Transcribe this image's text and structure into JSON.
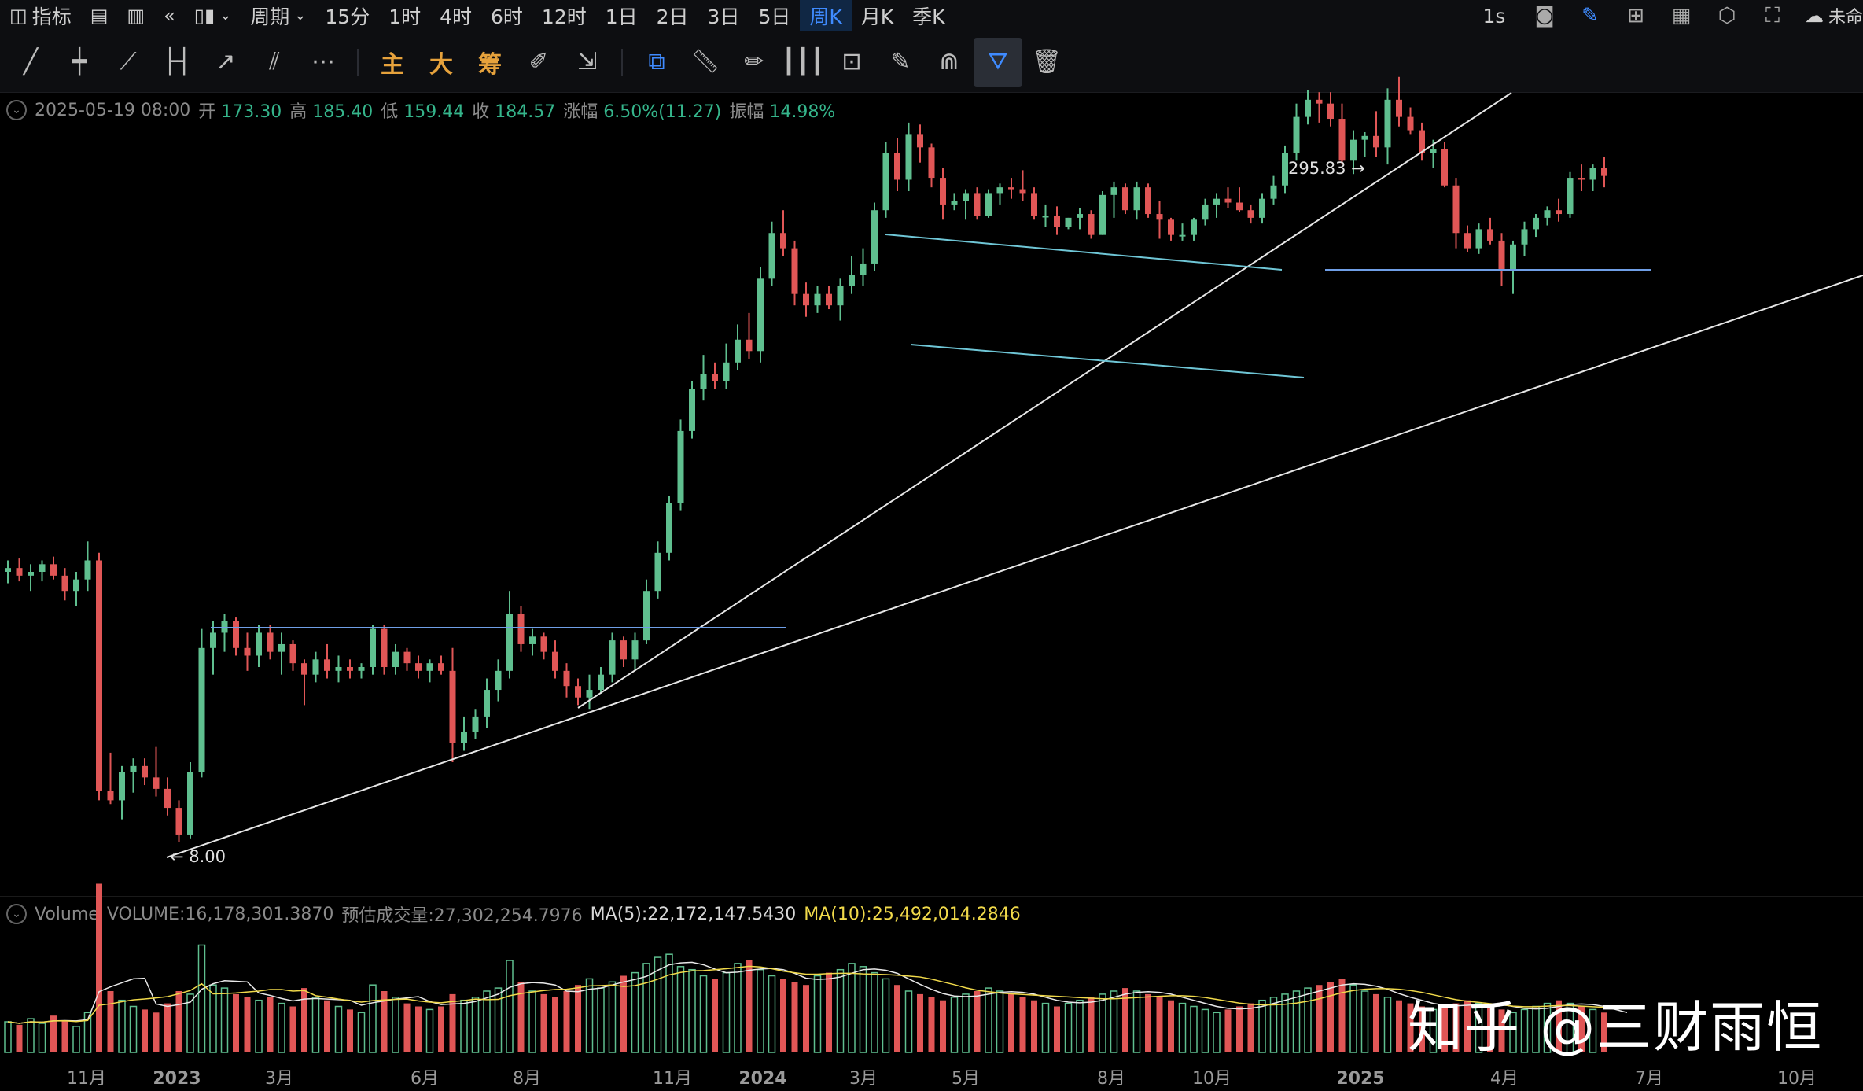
{
  "toolbar": {
    "indicators_label": "指标",
    "period_label": "周期",
    "periods": [
      "15分",
      "1时",
      "4时",
      "6时",
      "12时",
      "1日",
      "2日",
      "3日",
      "5日",
      "周K",
      "月K",
      "季K"
    ],
    "active_period": "周K",
    "interval_label": "1s",
    "cloud_label": "未命"
  },
  "drawing_tools": {
    "main_label": "主",
    "big_label": "大",
    "chip_label": "筹"
  },
  "ohlc": {
    "date": "2025-05-19 08:00",
    "open_label": "开",
    "open": "173.30",
    "high_label": "高",
    "high": "185.40",
    "low_label": "低",
    "low": "159.44",
    "close_label": "收",
    "close": "184.57",
    "change_label": "涨幅",
    "change": "6.50%(11.27)",
    "amp_label": "振幅",
    "amp": "14.98%"
  },
  "volume_info": {
    "name": "Volume",
    "volume": "VOLUME:16,178,301.3870",
    "estimate": "预估成交量:27,302,254.7976",
    "ma5": "MA(5):22,172,147.5430",
    "ma10": "MA(10):25,492,014.2846"
  },
  "annotations": {
    "high_mark": "295.83 →",
    "low_mark": "← 8.00"
  },
  "watermark": "知乎 @三财雨恒",
  "colors": {
    "up": "#5fbf8f",
    "down": "#e05656",
    "accent": "#3f8bff",
    "trendline": "#e6e6e6",
    "channel": "#6fc6d6",
    "level": "#6f9ee6"
  },
  "chart_data": {
    "type": "candlestick",
    "period": "weekly",
    "x_tick_labels": [
      "11月",
      "2023",
      "3月",
      "6月",
      "8月",
      "11月",
      "2024",
      "3月",
      "5月",
      "8月",
      "10月",
      "2025",
      "4月",
      "7月",
      "10月"
    ],
    "price_annotations": {
      "high": 295.83,
      "low": 8.0
    },
    "candles": [
      {
        "o": 150,
        "h": 156,
        "l": 144,
        "c": 152
      },
      {
        "o": 152,
        "h": 157,
        "l": 145,
        "c": 148
      },
      {
        "o": 148,
        "h": 154,
        "l": 140,
        "c": 150
      },
      {
        "o": 150,
        "h": 156,
        "l": 145,
        "c": 154
      },
      {
        "o": 154,
        "h": 158,
        "l": 146,
        "c": 148
      },
      {
        "o": 148,
        "h": 152,
        "l": 135,
        "c": 140
      },
      {
        "o": 140,
        "h": 150,
        "l": 132,
        "c": 146
      },
      {
        "o": 146,
        "h": 166,
        "l": 140,
        "c": 156
      },
      {
        "o": 156,
        "h": 160,
        "l": 30,
        "c": 35
      },
      {
        "o": 35,
        "h": 55,
        "l": 28,
        "c": 30
      },
      {
        "o": 30,
        "h": 48,
        "l": 20,
        "c": 45
      },
      {
        "o": 45,
        "h": 52,
        "l": 34,
        "c": 48
      },
      {
        "o": 48,
        "h": 52,
        "l": 38,
        "c": 42
      },
      {
        "o": 42,
        "h": 58,
        "l": 32,
        "c": 36
      },
      {
        "o": 36,
        "h": 42,
        "l": 22,
        "c": 26
      },
      {
        "o": 26,
        "h": 30,
        "l": 8,
        "c": 12
      },
      {
        "o": 12,
        "h": 50,
        "l": 10,
        "c": 45
      },
      {
        "o": 45,
        "h": 120,
        "l": 42,
        "c": 110
      },
      {
        "o": 110,
        "h": 124,
        "l": 96,
        "c": 118
      },
      {
        "o": 118,
        "h": 128,
        "l": 108,
        "c": 124
      },
      {
        "o": 124,
        "h": 126,
        "l": 106,
        "c": 110
      },
      {
        "o": 110,
        "h": 118,
        "l": 98,
        "c": 106
      },
      {
        "o": 106,
        "h": 122,
        "l": 100,
        "c": 118
      },
      {
        "o": 118,
        "h": 122,
        "l": 104,
        "c": 108
      },
      {
        "o": 108,
        "h": 118,
        "l": 96,
        "c": 112
      },
      {
        "o": 112,
        "h": 114,
        "l": 98,
        "c": 102
      },
      {
        "o": 102,
        "h": 104,
        "l": 80,
        "c": 96
      },
      {
        "o": 96,
        "h": 108,
        "l": 92,
        "c": 104
      },
      {
        "o": 104,
        "h": 112,
        "l": 94,
        "c": 98
      },
      {
        "o": 98,
        "h": 106,
        "l": 92,
        "c": 100
      },
      {
        "o": 100,
        "h": 104,
        "l": 94,
        "c": 98
      },
      {
        "o": 98,
        "h": 102,
        "l": 94,
        "c": 100
      },
      {
        "o": 100,
        "h": 122,
        "l": 96,
        "c": 120
      },
      {
        "o": 120,
        "h": 122,
        "l": 96,
        "c": 100
      },
      {
        "o": 100,
        "h": 112,
        "l": 96,
        "c": 108
      },
      {
        "o": 108,
        "h": 110,
        "l": 98,
        "c": 102
      },
      {
        "o": 102,
        "h": 106,
        "l": 94,
        "c": 98
      },
      {
        "o": 98,
        "h": 104,
        "l": 92,
        "c": 102
      },
      {
        "o": 102,
        "h": 106,
        "l": 96,
        "c": 98
      },
      {
        "o": 98,
        "h": 110,
        "l": 50,
        "c": 60
      },
      {
        "o": 60,
        "h": 74,
        "l": 56,
        "c": 66
      },
      {
        "o": 66,
        "h": 78,
        "l": 62,
        "c": 74
      },
      {
        "o": 74,
        "h": 94,
        "l": 68,
        "c": 88
      },
      {
        "o": 88,
        "h": 104,
        "l": 82,
        "c": 98
      },
      {
        "o": 98,
        "h": 140,
        "l": 94,
        "c": 128
      },
      {
        "o": 128,
        "h": 132,
        "l": 108,
        "c": 112
      },
      {
        "o": 112,
        "h": 120,
        "l": 106,
        "c": 116
      },
      {
        "o": 116,
        "h": 118,
        "l": 104,
        "c": 108
      },
      {
        "o": 108,
        "h": 114,
        "l": 94,
        "c": 98
      },
      {
        "o": 98,
        "h": 102,
        "l": 84,
        "c": 90
      },
      {
        "o": 90,
        "h": 94,
        "l": 80,
        "c": 84
      },
      {
        "o": 84,
        "h": 96,
        "l": 78,
        "c": 88
      },
      {
        "o": 88,
        "h": 100,
        "l": 86,
        "c": 96
      },
      {
        "o": 96,
        "h": 118,
        "l": 92,
        "c": 114
      },
      {
        "o": 114,
        "h": 116,
        "l": 100,
        "c": 104
      },
      {
        "o": 104,
        "h": 118,
        "l": 98,
        "c": 114
      },
      {
        "o": 114,
        "h": 146,
        "l": 112,
        "c": 140
      },
      {
        "o": 140,
        "h": 166,
        "l": 136,
        "c": 160
      },
      {
        "o": 160,
        "h": 190,
        "l": 156,
        "c": 186
      },
      {
        "o": 186,
        "h": 230,
        "l": 182,
        "c": 224
      },
      {
        "o": 224,
        "h": 250,
        "l": 220,
        "c": 246
      },
      {
        "o": 246,
        "h": 264,
        "l": 240,
        "c": 254
      },
      {
        "o": 254,
        "h": 260,
        "l": 246,
        "c": 250
      },
      {
        "o": 250,
        "h": 270,
        "l": 246,
        "c": 260
      },
      {
        "o": 260,
        "h": 280,
        "l": 256,
        "c": 272
      },
      {
        "o": 272,
        "h": 286,
        "l": 262,
        "c": 266
      },
      {
        "o": 266,
        "h": 310,
        "l": 260,
        "c": 304
      },
      {
        "o": 304,
        "h": 334,
        "l": 300,
        "c": 328
      },
      {
        "o": 328,
        "h": 340,
        "l": 316,
        "c": 320
      },
      {
        "o": 320,
        "h": 324,
        "l": 290,
        "c": 296
      },
      {
        "o": 296,
        "h": 302,
        "l": 284,
        "c": 290
      },
      {
        "o": 290,
        "h": 300,
        "l": 286,
        "c": 296
      },
      {
        "o": 296,
        "h": 300,
        "l": 288,
        "c": 290
      },
      {
        "o": 290,
        "h": 304,
        "l": 282,
        "c": 300
      },
      {
        "o": 300,
        "h": 316,
        "l": 296,
        "c": 306
      },
      {
        "o": 306,
        "h": 320,
        "l": 300,
        "c": 312
      },
      {
        "o": 312,
        "h": 344,
        "l": 308,
        "c": 340
      },
      {
        "o": 340,
        "h": 376,
        "l": 336,
        "c": 370
      },
      {
        "o": 370,
        "h": 378,
        "l": 350,
        "c": 356
      },
      {
        "o": 356,
        "h": 386,
        "l": 350,
        "c": 380
      },
      {
        "o": 380,
        "h": 385,
        "l": 365,
        "c": 373
      },
      {
        "o": 373,
        "h": 375,
        "l": 352,
        "c": 357
      },
      {
        "o": 357,
        "h": 362,
        "l": 335,
        "c": 343
      },
      {
        "o": 343,
        "h": 349,
        "l": 340,
        "c": 345
      },
      {
        "o": 345,
        "h": 351,
        "l": 335,
        "c": 349
      },
      {
        "o": 349,
        "h": 352,
        "l": 335,
        "c": 337
      },
      {
        "o": 337,
        "h": 351,
        "l": 336,
        "c": 349
      },
      {
        "o": 349,
        "h": 354,
        "l": 343,
        "c": 352
      },
      {
        "o": 352,
        "h": 357,
        "l": 346,
        "c": 351
      },
      {
        "o": 351,
        "h": 361,
        "l": 345,
        "c": 349
      },
      {
        "o": 349,
        "h": 352,
        "l": 335,
        "c": 337
      },
      {
        "o": 337,
        "h": 343,
        "l": 331,
        "c": 337
      },
      {
        "o": 337,
        "h": 342,
        "l": 327,
        "c": 331
      },
      {
        "o": 331,
        "h": 336,
        "l": 330,
        "c": 336
      },
      {
        "o": 336,
        "h": 341,
        "l": 330,
        "c": 338
      },
      {
        "o": 338,
        "h": 340,
        "l": 325,
        "c": 327
      },
      {
        "o": 327,
        "h": 350,
        "l": 327,
        "c": 348
      },
      {
        "o": 348,
        "h": 355,
        "l": 336,
        "c": 352
      },
      {
        "o": 352,
        "h": 354,
        "l": 338,
        "c": 340
      },
      {
        "o": 340,
        "h": 355,
        "l": 335,
        "c": 352
      },
      {
        "o": 352,
        "h": 354,
        "l": 336,
        "c": 338
      },
      {
        "o": 338,
        "h": 345,
        "l": 325,
        "c": 335
      },
      {
        "o": 335,
        "h": 336,
        "l": 324,
        "c": 327
      },
      {
        "o": 327,
        "h": 333,
        "l": 324,
        "c": 327
      },
      {
        "o": 327,
        "h": 336,
        "l": 324,
        "c": 335
      },
      {
        "o": 335,
        "h": 346,
        "l": 332,
        "c": 343
      },
      {
        "o": 343,
        "h": 349,
        "l": 336,
        "c": 346
      },
      {
        "o": 346,
        "h": 352,
        "l": 341,
        "c": 344
      },
      {
        "o": 344,
        "h": 352,
        "l": 339,
        "c": 340
      },
      {
        "o": 340,
        "h": 343,
        "l": 333,
        "c": 336
      },
      {
        "o": 336,
        "h": 349,
        "l": 333,
        "c": 346
      },
      {
        "o": 346,
        "h": 358,
        "l": 343,
        "c": 353
      },
      {
        "o": 353,
        "h": 374,
        "l": 349,
        "c": 370
      },
      {
        "o": 370,
        "h": 396,
        "l": 366,
        "c": 389
      },
      {
        "o": 389,
        "h": 403,
        "l": 385,
        "c": 398
      },
      {
        "o": 398,
        "h": 402,
        "l": 386,
        "c": 396
      },
      {
        "o": 396,
        "h": 402,
        "l": 384,
        "c": 388
      },
      {
        "o": 388,
        "h": 396,
        "l": 364,
        "c": 366
      },
      {
        "o": 366,
        "h": 382,
        "l": 359,
        "c": 377
      },
      {
        "o": 377,
        "h": 381,
        "l": 368,
        "c": 379
      },
      {
        "o": 379,
        "h": 392,
        "l": 368,
        "c": 373
      },
      {
        "o": 373,
        "h": 404,
        "l": 364,
        "c": 398
      },
      {
        "o": 398,
        "h": 410,
        "l": 384,
        "c": 389
      },
      {
        "o": 389,
        "h": 394,
        "l": 380,
        "c": 382
      },
      {
        "o": 382,
        "h": 386,
        "l": 366,
        "c": 370
      },
      {
        "o": 370,
        "h": 377,
        "l": 362,
        "c": 372
      },
      {
        "o": 372,
        "h": 376,
        "l": 352,
        "c": 353
      },
      {
        "o": 353,
        "h": 357,
        "l": 320,
        "c": 328
      },
      {
        "o": 328,
        "h": 332,
        "l": 318,
        "c": 320
      },
      {
        "o": 320,
        "h": 333,
        "l": 317,
        "c": 330
      },
      {
        "o": 330,
        "h": 336,
        "l": 322,
        "c": 324
      },
      {
        "o": 324,
        "h": 328,
        "l": 300,
        "c": 308
      },
      {
        "o": 308,
        "h": 324,
        "l": 296,
        "c": 322
      },
      {
        "o": 322,
        "h": 334,
        "l": 316,
        "c": 330
      },
      {
        "o": 330,
        "h": 338,
        "l": 326,
        "c": 336
      },
      {
        "o": 336,
        "h": 342,
        "l": 332,
        "c": 340
      },
      {
        "o": 340,
        "h": 346,
        "l": 334,
        "c": 338
      },
      {
        "o": 338,
        "h": 360,
        "l": 336,
        "c": 357
      },
      {
        "o": 357,
        "h": 364,
        "l": 350,
        "c": 356
      },
      {
        "o": 356,
        "h": 364,
        "l": 350,
        "c": 362
      },
      {
        "o": 362,
        "h": 368,
        "l": 352,
        "c": 358
      }
    ],
    "volumes": [
      20,
      18,
      22,
      19,
      24,
      21,
      17,
      26,
      110,
      40,
      34,
      30,
      28,
      26,
      32,
      40,
      38,
      70,
      44,
      42,
      38,
      36,
      34,
      36,
      32,
      30,
      42,
      36,
      34,
      30,
      28,
      26,
      44,
      40,
      36,
      32,
      30,
      28,
      30,
      38,
      34,
      36,
      40,
      42,
      60,
      46,
      40,
      38,
      36,
      40,
      44,
      48,
      42,
      46,
      50,
      52,
      58,
      62,
      64,
      56,
      54,
      50,
      48,
      52,
      58,
      60,
      54,
      50,
      48,
      46,
      44,
      50,
      52,
      54,
      58,
      56,
      52,
      48,
      44,
      40,
      38,
      36,
      34,
      36,
      38,
      40,
      42,
      40,
      38,
      36,
      34,
      32,
      30,
      32,
      34,
      36,
      38,
      40,
      42,
      40,
      38,
      36,
      34,
      32,
      30,
      28,
      26,
      28,
      30,
      32,
      34,
      36,
      38,
      40,
      42,
      44,
      46,
      48,
      44,
      40,
      38,
      36,
      34,
      32,
      30,
      28,
      30,
      32,
      34,
      32,
      30,
      28,
      26,
      28,
      30,
      32,
      34,
      32,
      30,
      28,
      26,
      24,
      22
    ]
  }
}
